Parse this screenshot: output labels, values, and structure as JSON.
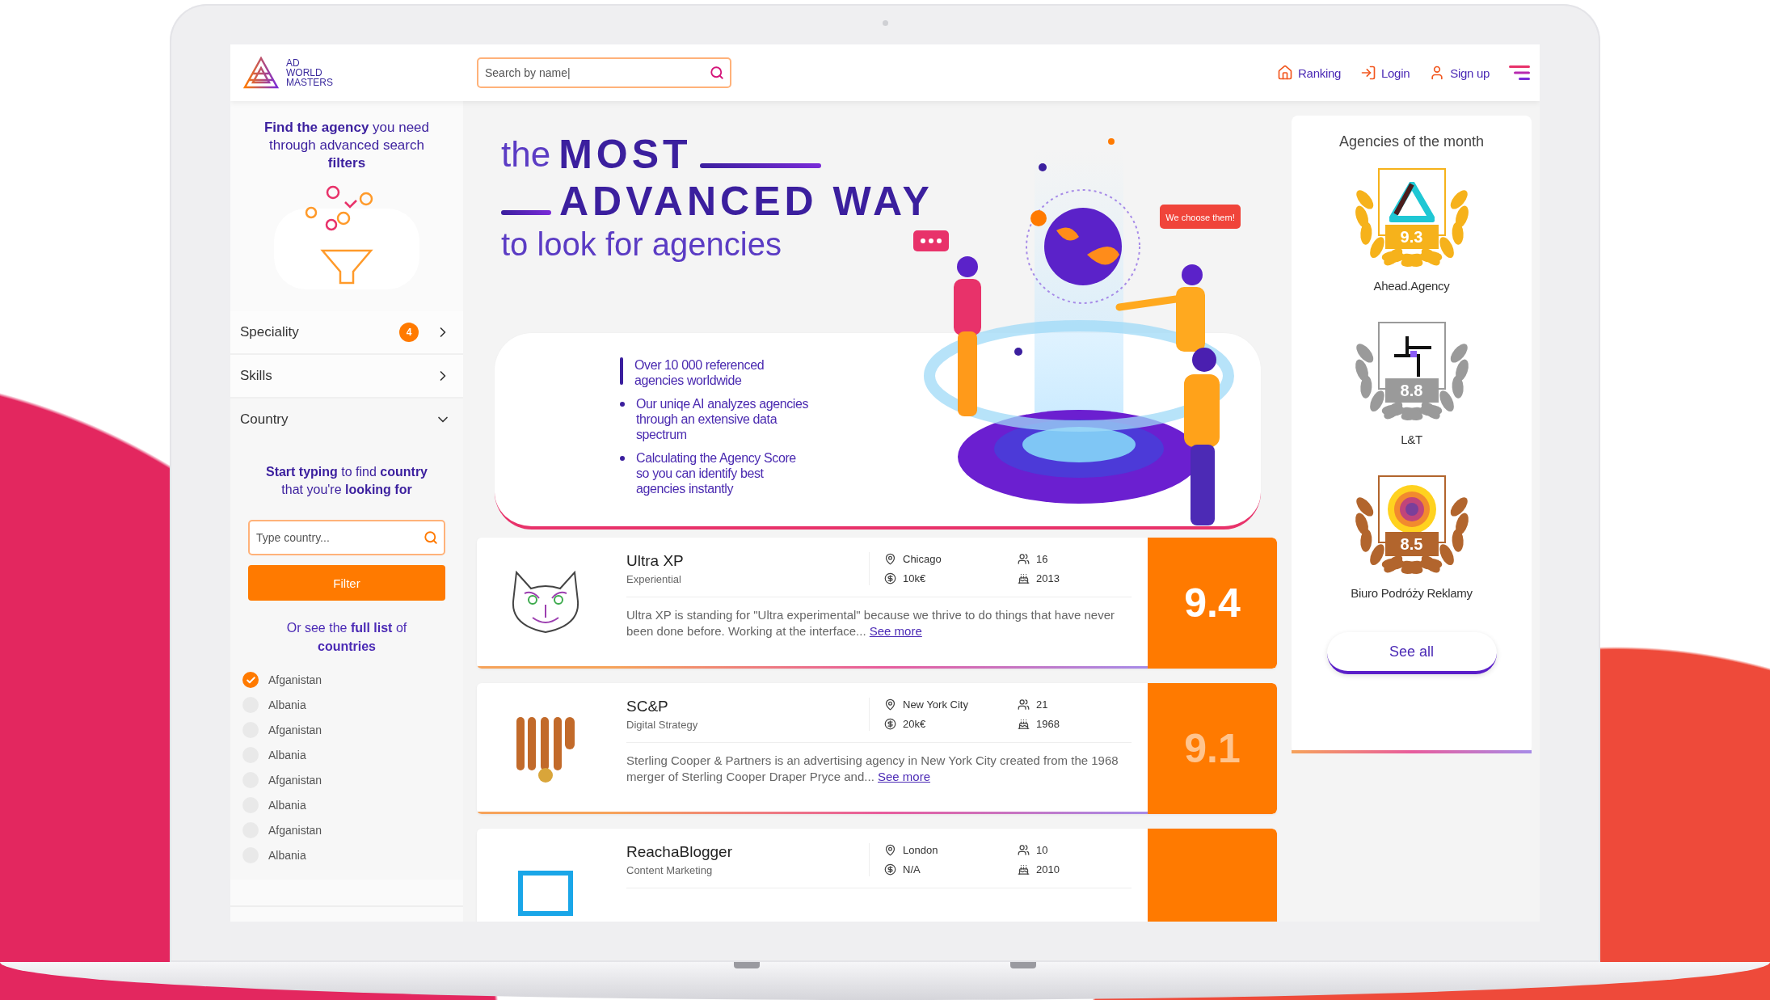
{
  "logo": {
    "lines": [
      "AD",
      "WORLD",
      "MASTERS"
    ]
  },
  "search": {
    "placeholder": "Search by name|"
  },
  "nav": [
    {
      "label": "Ranking"
    },
    {
      "label": "Login"
    },
    {
      "label": "Sign up"
    }
  ],
  "sidebar": {
    "intro": "**Find the agency** you need through advanced search **filters**",
    "filters": [
      {
        "label": "Speciality",
        "badge": "4",
        "expanded": false
      },
      {
        "label": "Skills",
        "expanded": false
      },
      {
        "label": "Country",
        "expanded": true
      }
    ],
    "country": {
      "hint": "**Start typing** to find **country** that you're **looking for**",
      "placeholder": "Type country...",
      "button": "Filter",
      "full_list": "Or see the **full list** of **countries**",
      "options": [
        {
          "label": "Afganistan",
          "checked": true
        },
        {
          "label": "Albania",
          "checked": false
        },
        {
          "label": "Afganistan",
          "checked": false
        },
        {
          "label": "Albania",
          "checked": false
        },
        {
          "label": "Afganistan",
          "checked": false
        },
        {
          "label": "Albania",
          "checked": false
        },
        {
          "label": "Afganistan",
          "checked": false
        },
        {
          "label": "Albania",
          "checked": false
        }
      ]
    }
  },
  "hero": {
    "title_small": "the",
    "title_bold_1": "MOST",
    "title_bold_2": "ADVANCED WAY",
    "subtitle": "to look for agencies",
    "bubble": "We choose them!",
    "bullets": [
      {
        "text": "Over 10 000 referenced agencies worldwide",
        "selected": true
      },
      {
        "text": "Our uniqe AI analyzes agencies through an extensive data spectrum",
        "selected": false
      },
      {
        "text": "Calculating the Agency Score so you can identify best agencies instantly",
        "selected": false
      }
    ]
  },
  "agencies": [
    {
      "name": "Ultra XP",
      "category": "Experiential",
      "city": "Chicago",
      "budget": "10k€",
      "employees": "16",
      "founded": "2013",
      "description": "Ultra XP is standing for \"Ultra experimental\" because we thrive to do things that have never been done before. Working at the interface...",
      "link": "See more",
      "score": "9.4",
      "dimmed": false
    },
    {
      "name": "SC&P",
      "category": "Digital Strategy",
      "city": "New York City",
      "budget": "20k€",
      "employees": "21",
      "founded": "1968",
      "description": "Sterling Cooper & Partners is an advertising agency in New York City created from the 1968 merger of Sterling Cooper Draper Pryce and...",
      "link": "See more",
      "score": "9.1",
      "dimmed": true
    },
    {
      "name": "ReachaBlogger",
      "category": "Content Marketing",
      "city": "London",
      "budget": "N/A",
      "employees": "10",
      "founded": "2010"
    }
  ],
  "agencies_of_month": {
    "title": "Agencies of the month",
    "button": "See all",
    "items": [
      {
        "name": "Ahead.Agency",
        "score": "9.3",
        "color": "#f6b21b"
      },
      {
        "name": "L&T",
        "score": "8.8",
        "color": "#9a9a9a"
      },
      {
        "name": "Biuro Podróży Reklamy",
        "score": "8.5",
        "color": "#b2652d"
      }
    ]
  }
}
